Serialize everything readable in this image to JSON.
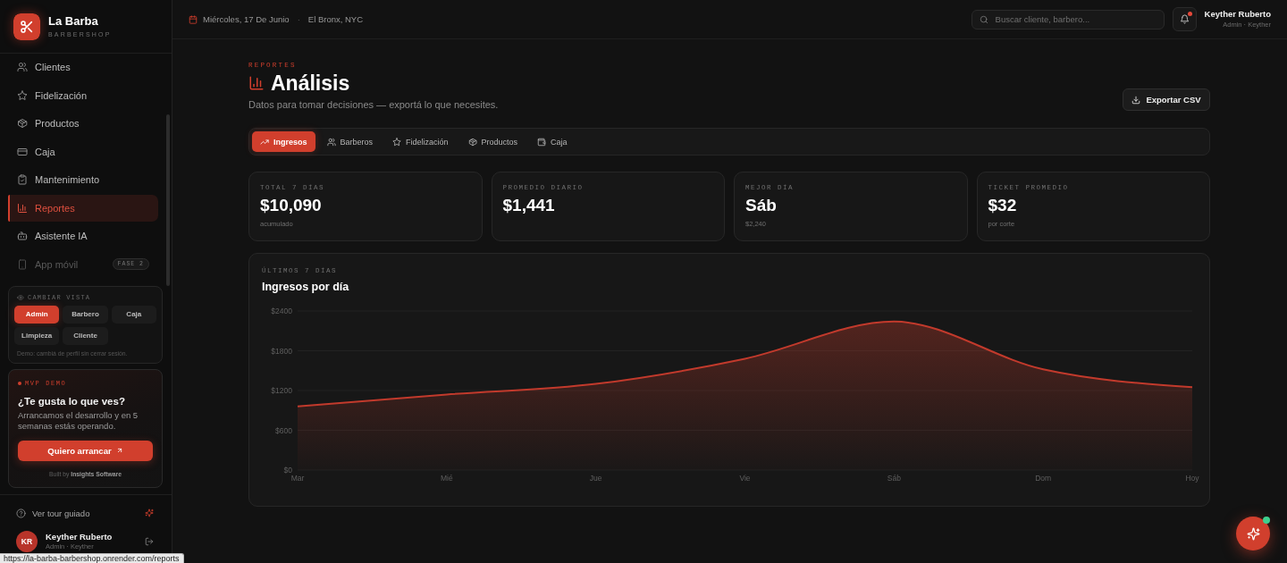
{
  "sidebar": {
    "brand": {
      "name": "La Barba",
      "tagline": "BARBERSHOP"
    },
    "nav": [
      {
        "label": "Clientes",
        "selected": false,
        "disabled": false
      },
      {
        "label": "Fidelización",
        "selected": false,
        "disabled": false
      },
      {
        "label": "Productos",
        "selected": false,
        "disabled": false
      },
      {
        "label": "Caja",
        "selected": false,
        "disabled": false
      },
      {
        "label": "Mantenimiento",
        "selected": false,
        "disabled": false
      },
      {
        "label": "Reportes",
        "selected": true,
        "disabled": false
      },
      {
        "label": "Asistente IA",
        "selected": false,
        "disabled": false
      },
      {
        "label": "App móvil",
        "selected": false,
        "disabled": true,
        "badge": "FASE 2"
      }
    ],
    "view_switcher": {
      "title": "CAMBIAR VISTA",
      "options": [
        {
          "label": "Admin",
          "selected": true
        },
        {
          "label": "Barbero",
          "selected": false
        },
        {
          "label": "Caja",
          "selected": false
        },
        {
          "label": "Limpieza",
          "selected": false
        },
        {
          "label": "Cliente",
          "selected": false
        }
      ],
      "note": "Demo: cambiá de perfil sin cerrar sesión."
    },
    "promo": {
      "eyebrow": "MVP DEMO",
      "title": "¿Te gusta lo que ves?",
      "text": "Arrancamos el desarrollo y en 5 semanas estás operando.",
      "button": "Quiero arrancar",
      "credit": "Built by **Insights Software**"
    },
    "tour": {
      "label": "Ver tour guiado"
    },
    "user": {
      "initials": "KR",
      "name": "Keyther Ruberto",
      "role": "Admin · Keyther"
    }
  },
  "topbar": {
    "date": "Miércoles, 17 De Junio",
    "separator": "·",
    "location": "El Bronx, NYC",
    "search": {
      "placeholder": "Buscar cliente, barbero..."
    },
    "notifications": {
      "unread": true
    },
    "user": {
      "name": "Keyther Ruberto",
      "role": "Admin · Keyther"
    }
  },
  "header": {
    "eyebrow": "REPORTES",
    "title": "Análisis",
    "subtitle": "Datos para tomar decisiones — exportá lo que necesites.",
    "export_button": "Exportar CSV"
  },
  "tabs": [
    {
      "label": "Ingresos",
      "selected": true
    },
    {
      "label": "Barberos",
      "selected": false
    },
    {
      "label": "Fidelización",
      "selected": false
    },
    {
      "label": "Productos",
      "selected": false
    },
    {
      "label": "Caja",
      "selected": false
    }
  ],
  "stats": [
    {
      "label": "TOTAL 7 DÍAS",
      "value": "$10,090",
      "note": "acumulado"
    },
    {
      "label": "PROMEDIO DIARIO",
      "value": "$1,441"
    },
    {
      "label": "MEJOR DÍA",
      "value": "Sáb",
      "note": "$2,240"
    },
    {
      "label": "TICKET PROMEDIO",
      "value": "$32",
      "note": "por corte"
    }
  ],
  "chart": {
    "eyebrow": "ÚLTIMOS 7 DÍAS",
    "chart_data": {
      "type": "area",
      "title": "Ingresos por día",
      "categories": [
        "Mar",
        "Mié",
        "Jue",
        "Vie",
        "Sáb",
        "Dom",
        "Hoy"
      ],
      "values": [
        960,
        1140,
        1300,
        1680,
        2240,
        1520,
        1250
      ],
      "ylim": [
        0,
        2400
      ],
      "yticks": [
        {
          "value": 0,
          "label": "$0"
        },
        {
          "value": 600,
          "label": "$600"
        },
        {
          "value": 1200,
          "label": "$1200"
        },
        {
          "value": 1800,
          "label": "$1800"
        },
        {
          "value": 2400,
          "label": "$2400"
        }
      ]
    }
  },
  "assistant_button": {
    "online": true
  },
  "browser_status": {
    "url": "https://la-barba-barbershop.onrender.com/reports"
  }
}
